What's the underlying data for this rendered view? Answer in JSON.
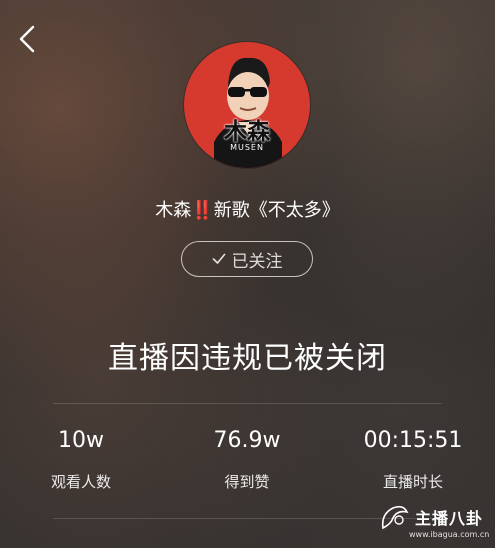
{
  "header": {
    "back_icon": "chevron-left-icon"
  },
  "anchor": {
    "avatar_name": "木森",
    "avatar_sub": "MUSEN",
    "title_prefix": "木森",
    "title_bang": "‼️",
    "title_suffix": "新歌《不太多》"
  },
  "follow_button": {
    "label": "已关注",
    "icon": "check-icon"
  },
  "status": {
    "message": "直播因违规已被关闭"
  },
  "stats": [
    {
      "value": "10w",
      "label": "观看人数"
    },
    {
      "value": "76.9w",
      "label": "得到赞"
    },
    {
      "value": "00:15:51",
      "label": "直播时长"
    }
  ],
  "watermark": {
    "text": "主播八卦",
    "url": "www.ibagua.com.cn"
  },
  "colors": {
    "avatar_bg": "#d63a2f",
    "bang": "#e6342c"
  }
}
